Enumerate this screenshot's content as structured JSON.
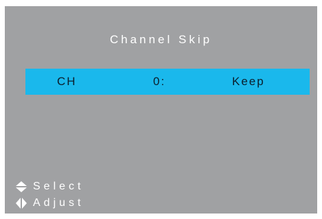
{
  "menu": {
    "title": "Channel Skip"
  },
  "selected_row": {
    "label": "CH",
    "channel": "0:",
    "value": "Keep"
  },
  "hints": [
    {
      "icon": "up-down-arrows-icon",
      "label": "Select"
    },
    {
      "icon": "left-right-arrows-icon",
      "label": "Adjust"
    }
  ],
  "colors": {
    "background": "#a0a1a3",
    "highlight": "#1ab8ec",
    "text": "#ffffff",
    "highlight_text": "#0b1e2c"
  }
}
